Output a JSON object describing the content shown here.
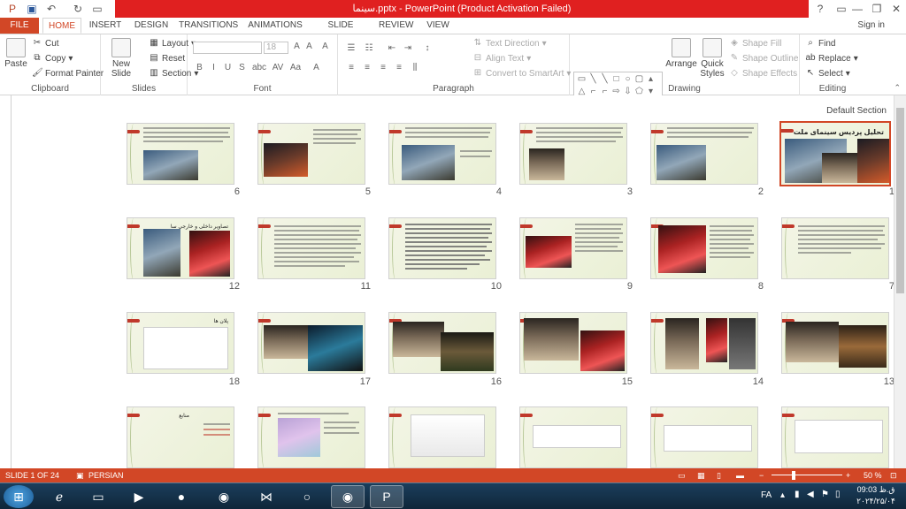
{
  "window": {
    "title": "سینما.pptx - PowerPoint (Product Activation Failed)",
    "controls": [
      "?",
      "—",
      "❐",
      "✕"
    ]
  },
  "tabs": [
    "FILE",
    "HOME",
    "INSERT",
    "DESIGN",
    "TRANSITIONS",
    "ANIMATIONS",
    "SLIDE SHOW",
    "REVIEW",
    "VIEW"
  ],
  "signin": "Sign in",
  "ribbon": {
    "clipboard": {
      "label": "Clipboard",
      "paste": "Paste",
      "cut": "Cut",
      "copy": "Copy",
      "format_painter": "Format Painter"
    },
    "slides": {
      "label": "Slides",
      "new_slide": "New Slide",
      "layout": "Layout",
      "reset": "Reset",
      "section": "Section"
    },
    "font": {
      "label": "Font",
      "size": "18",
      "buttons": [
        "B",
        "I",
        "U",
        "S",
        "abc",
        "AV",
        "Aa",
        "A"
      ]
    },
    "paragraph": {
      "label": "Paragraph",
      "text_direction": "Text Direction",
      "align_text": "Align Text",
      "convert_smartart": "Convert to SmartArt"
    },
    "drawing": {
      "label": "Drawing",
      "arrange": "Arrange",
      "quick_styles": "Quick Styles",
      "shape_fill": "Shape Fill",
      "shape_outline": "Shape Outline",
      "shape_effects": "Shape Effects"
    },
    "editing": {
      "label": "Editing",
      "find": "Find",
      "replace": "Replace",
      "select": "Select"
    }
  },
  "sorter": {
    "section": "Default Section",
    "row1": [
      "6",
      "5",
      "4",
      "3",
      "2",
      "1"
    ],
    "row2": [
      "12",
      "11",
      "10",
      "9",
      "8",
      "7"
    ],
    "row3": [
      "18",
      "17",
      "16",
      "15",
      "14",
      "13"
    ],
    "slide1_title": "تحلیل پردیس سینمای ملت",
    "slide12_title": "تصاویر داخلی و خارجی سا",
    "slide18_title": "پلان ها",
    "slide19_title": "منابع"
  },
  "status": {
    "slide": "SLIDE 1 OF 24",
    "language": "PERSIAN",
    "zoom": "50 %"
  },
  "taskbar": {
    "lang": "FA",
    "time": "09:03 ق.ظ",
    "date": "۲۰۲۴/۲۵/۰۴"
  }
}
